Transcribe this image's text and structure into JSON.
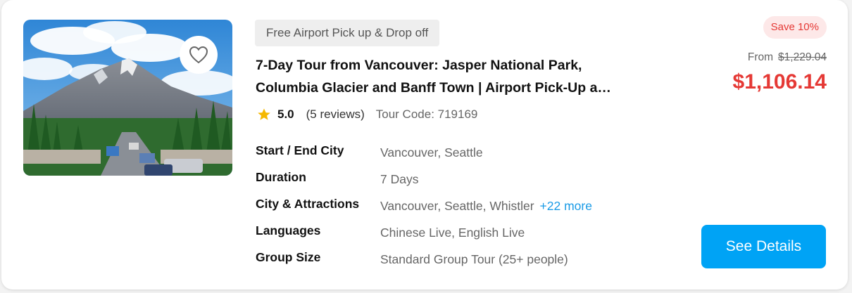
{
  "card": {
    "tag": "Free Airport Pick up & Drop off",
    "title_line1": "7-Day Tour from Vancouver: Jasper National Park,",
    "title_line2": "Columbia Glacier and Banff Town | Airport Pick-Up a…",
    "rating": {
      "score": "5.0",
      "reviews": "(5 reviews)",
      "tour_code": "Tour Code: 719169",
      "icon": "star-icon",
      "color": "#f5b800"
    },
    "details": [
      {
        "label": "Start / End City",
        "value": "Vancouver, Seattle"
      },
      {
        "label": "Duration",
        "value": "7 Days"
      },
      {
        "label": "City & Attractions",
        "value": "Vancouver, Seattle, Whistler",
        "more": "+22 more"
      },
      {
        "label": "Languages",
        "value": "Chinese Live, English Live"
      },
      {
        "label": "Group Size",
        "value": "Standard Group Tour (25+ people)"
      }
    ],
    "favorite_icon": "heart-icon",
    "pricing": {
      "badge": "Save 10%",
      "from_label": "From",
      "original": "$1,229.04",
      "price": "$1,106.14",
      "color": "#e53935"
    },
    "cta_label": "See Details",
    "cta_color": "#00a3f5"
  }
}
